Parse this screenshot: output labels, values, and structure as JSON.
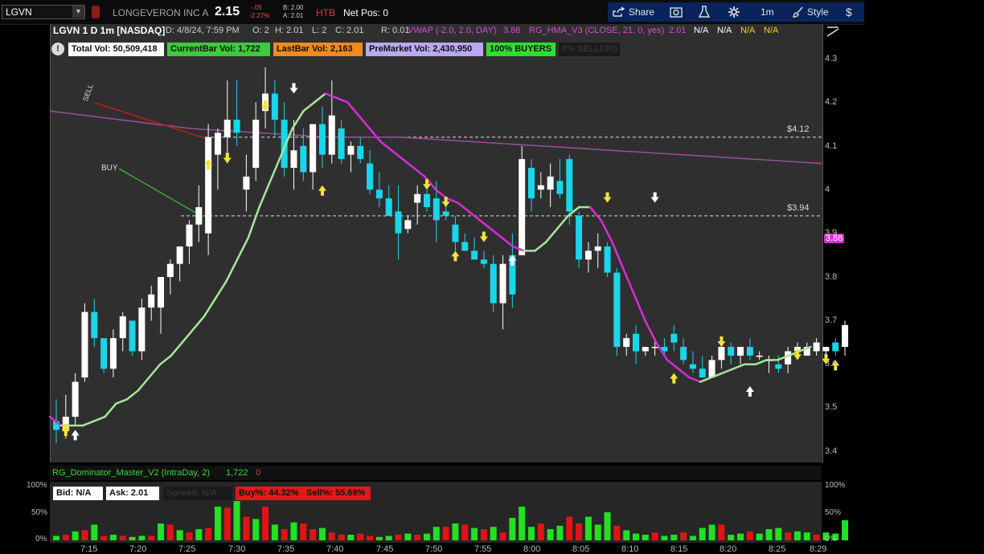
{
  "topbar": {
    "symbol": "LGVN",
    "company": "LONGEVERON INC A",
    "last": "2.15",
    "change": "-.05",
    "change_pct": "-2.27%",
    "bid": "B: 2.00",
    "ask": "A: 2.01",
    "htb": "HTB",
    "net_pos": "Net Pos: 0",
    "share_label": "Share",
    "timeframe": "1m",
    "style_label": "Style"
  },
  "header": {
    "title": "LGVN 1 D 1m [NASDAQ]",
    "date": "D: 4/8/24, 7:59 PM",
    "open": "O: 2",
    "high": "H: 2.01",
    "low": "L: 2",
    "close": "C: 2.01",
    "range": "R: 0.01",
    "vwap_label": "VWAP (-2.0, 2.0, DAY)",
    "vwap_value": "3.88",
    "hma_label": "RG_HMA_V3 (CLOSE, 21, 0, yes)",
    "hma_value": "2.01",
    "na1": "N/A",
    "na2": "N/A",
    "na3": "N/A",
    "na4": "N/A"
  },
  "stats": {
    "total_vol": "Total Vol: 50,509,418",
    "current_bar_vol": "CurrentBar Vol: 1,722",
    "last_bar_vol": "LastBar Vol: 2,163",
    "premarket_vol": "PreMarket Vol: 2,430,950",
    "buyers": "100% BUYERS",
    "sellers": "0% SELLERS"
  },
  "annotations": {
    "sell": "SELL",
    "buy": "BUY",
    "level_high": "$4.12",
    "level_low": "$3.94",
    "vwap_tag": "3.88"
  },
  "lower": {
    "study_label": "RG_Dominator_Master_V2 (IntraDay, 2)",
    "study_value": "1,722",
    "study_zero": "0",
    "bid": "Bid: N/A",
    "ask": "Ask: 2.01",
    "spread": "Spread: N/A",
    "buy_pct": "Buy%: 44.32%",
    "sell_pct": "Sell%: 55.68%",
    "axis_100_left": "100%",
    "axis_50_left": "50%",
    "axis_0_left": "0%",
    "axis_100_right": "100%",
    "axis_50_right": "50%",
    "axis_0_right": "0%"
  },
  "axes": {
    "price_ticks": [
      "4.3",
      "4.2",
      "4.1",
      "4",
      "3.9",
      "3.8",
      "3.7",
      "3.6",
      "3.5",
      "3.4"
    ],
    "time_ticks": [
      "7:15",
      "7:20",
      "7:25",
      "7:30",
      "7:35",
      "7:40",
      "7:45",
      "7:50",
      "7:55",
      "8:00",
      "8:05",
      "8:10",
      "8:15",
      "8:20",
      "8:25",
      "8:29"
    ]
  },
  "colors": {
    "up": "#ffffff",
    "down": "#19d6ea",
    "hma_up": "#a5e89a",
    "hma_down": "#d92bd9",
    "vwap": "#9b4f9b",
    "vol_buy": "#22e022",
    "vol_sell": "#e01414"
  },
  "chart_data": {
    "type": "candlestick",
    "x_start": "7:13",
    "x_end": "8:29",
    "interval": "1m",
    "ylim": [
      3.4,
      4.32
    ],
    "candles": [
      [
        3.47,
        3.52,
        3.42,
        3.45
      ],
      [
        3.45,
        3.53,
        3.43,
        3.48
      ],
      [
        3.48,
        3.58,
        3.46,
        3.56
      ],
      [
        3.57,
        3.74,
        3.56,
        3.72
      ],
      [
        3.72,
        3.75,
        3.64,
        3.66
      ],
      [
        3.66,
        3.66,
        3.58,
        3.59
      ],
      [
        3.59,
        3.68,
        3.57,
        3.66
      ],
      [
        3.66,
        3.72,
        3.63,
        3.71
      ],
      [
        3.7,
        3.7,
        3.62,
        3.63
      ],
      [
        3.63,
        3.75,
        3.61,
        3.73
      ],
      [
        3.73,
        3.78,
        3.7,
        3.76
      ],
      [
        3.73,
        3.8,
        3.67,
        3.8
      ],
      [
        3.8,
        3.84,
        3.76,
        3.83
      ],
      [
        3.83,
        3.87,
        3.79,
        3.87
      ],
      [
        3.87,
        3.93,
        3.83,
        3.92
      ],
      [
        3.92,
        4.01,
        3.88,
        3.96
      ],
      [
        3.9,
        4.15,
        3.85,
        4.12
      ],
      [
        4.08,
        4.14,
        4.0,
        4.13
      ],
      [
        4.12,
        4.25,
        4.06,
        4.16
      ],
      [
        4.16,
        4.25,
        4.1,
        4.13
      ],
      [
        4.0,
        4.08,
        3.95,
        4.03
      ],
      [
        4.05,
        4.2,
        4.02,
        4.16
      ],
      [
        4.18,
        4.28,
        4.14,
        4.22
      ],
      [
        4.22,
        4.25,
        4.12,
        4.16
      ],
      [
        4.16,
        4.2,
        4.03,
        4.05
      ],
      [
        4.05,
        4.16,
        4.0,
        4.09
      ],
      [
        4.1,
        4.14,
        4.02,
        4.04
      ],
      [
        4.04,
        4.1,
        4.0,
        4.15
      ],
      [
        4.15,
        4.19,
        4.05,
        4.08
      ],
      [
        4.08,
        4.25,
        4.06,
        4.17
      ],
      [
        4.14,
        4.16,
        4.06,
        4.07
      ],
      [
        4.08,
        4.11,
        4.04,
        4.1
      ],
      [
        4.1,
        4.12,
        4.06,
        4.07
      ],
      [
        4.06,
        4.09,
        3.99,
        4.0
      ],
      [
        4.0,
        4.04,
        3.96,
        3.98
      ],
      [
        3.98,
        4.01,
        3.94,
        3.94
      ],
      [
        3.95,
        4.01,
        3.84,
        3.9
      ],
      [
        3.91,
        3.94,
        3.9,
        3.93
      ],
      [
        3.97,
        4.01,
        3.92,
        3.99
      ],
      [
        3.99,
        4.0,
        3.95,
        3.96
      ],
      [
        3.98,
        4.02,
        3.88,
        3.93
      ],
      [
        3.95,
        3.97,
        3.93,
        3.94
      ],
      [
        3.92,
        3.94,
        3.86,
        3.88
      ],
      [
        3.88,
        3.9,
        3.86,
        3.86
      ],
      [
        3.86,
        3.89,
        3.84,
        3.84
      ],
      [
        3.84,
        3.86,
        3.82,
        3.83
      ],
      [
        3.83,
        3.85,
        3.72,
        3.74
      ],
      [
        3.74,
        3.85,
        3.68,
        3.83
      ],
      [
        3.85,
        3.9,
        3.73,
        3.76
      ],
      [
        3.85,
        4.1,
        3.85,
        4.07
      ],
      [
        4.05,
        4.07,
        3.95,
        3.98
      ],
      [
        4.0,
        4.04,
        3.98,
        4.01
      ],
      [
        4.0,
        4.06,
        3.96,
        4.03
      ],
      [
        4.02,
        4.07,
        3.98,
        3.99
      ],
      [
        4.07,
        4.08,
        3.92,
        3.95
      ],
      [
        3.94,
        3.95,
        3.82,
        3.84
      ],
      [
        3.84,
        3.88,
        3.81,
        3.86
      ],
      [
        3.86,
        3.9,
        3.82,
        3.87
      ],
      [
        3.87,
        3.88,
        3.8,
        3.81
      ],
      [
        3.81,
        3.82,
        3.62,
        3.64
      ],
      [
        3.64,
        3.67,
        3.62,
        3.66
      ],
      [
        3.67,
        3.69,
        3.6,
        3.63
      ],
      [
        3.63,
        3.64,
        3.62,
        3.64
      ],
      [
        3.64,
        3.66,
        3.62,
        3.64
      ],
      [
        3.64,
        3.66,
        3.62,
        3.63
      ],
      [
        3.67,
        3.69,
        3.63,
        3.65
      ],
      [
        3.64,
        3.66,
        3.6,
        3.61
      ],
      [
        3.6,
        3.63,
        3.58,
        3.59
      ],
      [
        3.59,
        3.62,
        3.57,
        3.57
      ],
      [
        3.57,
        3.62,
        3.57,
        3.61
      ],
      [
        3.61,
        3.65,
        3.59,
        3.64
      ],
      [
        3.64,
        3.65,
        3.6,
        3.62
      ],
      [
        3.62,
        3.64,
        3.6,
        3.64
      ],
      [
        3.64,
        3.66,
        3.61,
        3.62
      ],
      [
        3.62,
        3.63,
        3.61,
        3.62
      ],
      [
        3.61,
        3.62,
        3.58,
        3.61
      ],
      [
        3.6,
        3.62,
        3.58,
        3.59
      ],
      [
        3.6,
        3.64,
        3.58,
        3.63
      ],
      [
        3.63,
        3.65,
        3.61,
        3.64
      ],
      [
        3.62,
        3.65,
        3.62,
        3.64
      ],
      [
        3.63,
        3.66,
        3.62,
        3.65
      ],
      [
        3.63,
        3.64,
        3.62,
        3.64
      ],
      [
        3.65,
        3.66,
        3.62,
        3.63
      ],
      [
        3.64,
        3.7,
        3.62,
        3.69
      ]
    ],
    "hma": [
      [
        3.48,
        3.46
      ],
      [
        3.46,
        3.46
      ],
      [
        3.47,
        3.48
      ],
      [
        3.51,
        3.52
      ],
      [
        3.54,
        3.57
      ],
      [
        3.6,
        3.62
      ],
      [
        3.65,
        3.68
      ],
      [
        3.71,
        3.75
      ],
      [
        3.79,
        3.84
      ],
      [
        3.89,
        3.96
      ],
      [
        4.02,
        4.08
      ],
      [
        4.14,
        4.18
      ],
      [
        4.2,
        4.22
      ],
      [
        4.21,
        4.2
      ],
      [
        4.17,
        4.14
      ],
      [
        4.11,
        4.09
      ],
      [
        4.07,
        4.05
      ],
      [
        4.03,
        4.0
      ],
      [
        3.98,
        3.97
      ],
      [
        3.95,
        3.93
      ],
      [
        3.91,
        3.89
      ],
      [
        3.87,
        3.86
      ],
      [
        3.86,
        3.88
      ],
      [
        3.91,
        3.94
      ],
      [
        3.96,
        3.96
      ],
      [
        3.93,
        3.88
      ],
      [
        3.82,
        3.76
      ],
      [
        3.7,
        3.65
      ],
      [
        3.61,
        3.59
      ],
      [
        3.57,
        3.56
      ],
      [
        3.57,
        3.58
      ],
      [
        3.59,
        3.6
      ],
      [
        3.6,
        3.61
      ],
      [
        3.61,
        3.62
      ],
      [
        3.63,
        3.64
      ]
    ],
    "vwap": [
      [
        4.18,
        4.16
      ],
      [
        4.14,
        4.13
      ],
      [
        4.12,
        4.12
      ],
      [
        4.11,
        4.1
      ],
      [
        4.09,
        4.08
      ],
      [
        4.07,
        4.06
      ]
    ],
    "levels": [
      4.12,
      3.94
    ],
    "vwap_current": 3.88,
    "buy_arrows": [
      [
        7.14,
        3.46
      ],
      [
        7.29,
        4.07
      ],
      [
        7.41,
        4.01
      ],
      [
        7.55,
        3.86
      ],
      [
        7.78,
        3.58
      ],
      [
        7.95,
        3.61
      ]
    ],
    "sell_arrows": [
      [
        7.14,
        3.44
      ],
      [
        7.31,
        4.06
      ],
      [
        7.35,
        4.18
      ],
      [
        7.52,
        4.0
      ],
      [
        7.54,
        3.96
      ],
      [
        7.58,
        3.88
      ],
      [
        7.71,
        3.97
      ],
      [
        7.83,
        3.64
      ],
      [
        7.91,
        3.61
      ],
      [
        7.94,
        3.6
      ]
    ],
    "white_up_arrows": [
      [
        7.15,
        3.45
      ],
      [
        7.61,
        3.85
      ],
      [
        7.86,
        3.55
      ]
    ],
    "white_down_arrows": [
      [
        7.38,
        4.22
      ],
      [
        7.76,
        3.97
      ]
    ],
    "volume_pct": [
      [
        0,
        8
      ],
      [
        1,
        10
      ],
      [
        0,
        16
      ],
      [
        1,
        18
      ],
      [
        0,
        28
      ],
      [
        1,
        8
      ],
      [
        0,
        10
      ],
      [
        1,
        8
      ],
      [
        0,
        6
      ],
      [
        0,
        8
      ],
      [
        1,
        8
      ],
      [
        0,
        30
      ],
      [
        1,
        28
      ],
      [
        0,
        18
      ],
      [
        1,
        14
      ],
      [
        0,
        20
      ],
      [
        1,
        22
      ],
      [
        0,
        60
      ],
      [
        1,
        58
      ],
      [
        0,
        70
      ],
      [
        1,
        42
      ],
      [
        0,
        38
      ],
      [
        1,
        60
      ],
      [
        0,
        28
      ],
      [
        1,
        20
      ],
      [
        0,
        32
      ],
      [
        1,
        30
      ],
      [
        1,
        20
      ],
      [
        0,
        22
      ],
      [
        1,
        14
      ],
      [
        1,
        10
      ],
      [
        0,
        10
      ],
      [
        1,
        12
      ],
      [
        1,
        8
      ],
      [
        0,
        6
      ],
      [
        0,
        8
      ],
      [
        1,
        10
      ],
      [
        0,
        12
      ],
      [
        1,
        10
      ],
      [
        0,
        12
      ],
      [
        0,
        24
      ],
      [
        1,
        24
      ],
      [
        0,
        30
      ],
      [
        1,
        28
      ],
      [
        0,
        22
      ],
      [
        1,
        20
      ],
      [
        0,
        24
      ],
      [
        1,
        14
      ],
      [
        0,
        40
      ],
      [
        0,
        60
      ],
      [
        0,
        24
      ],
      [
        1,
        30
      ],
      [
        0,
        20
      ],
      [
        0,
        26
      ],
      [
        1,
        42
      ],
      [
        1,
        30
      ],
      [
        0,
        42
      ],
      [
        0,
        28
      ],
      [
        0,
        50
      ],
      [
        1,
        26
      ],
      [
        0,
        18
      ],
      [
        0,
        12
      ],
      [
        0,
        10
      ],
      [
        1,
        14
      ],
      [
        0,
        8
      ],
      [
        0,
        10
      ],
      [
        1,
        14
      ],
      [
        0,
        8
      ],
      [
        0,
        22
      ],
      [
        0,
        28
      ],
      [
        1,
        28
      ],
      [
        0,
        10
      ],
      [
        0,
        12
      ],
      [
        1,
        16
      ],
      [
        0,
        12
      ],
      [
        0,
        20
      ],
      [
        0,
        22
      ],
      [
        1,
        14
      ],
      [
        0,
        16
      ],
      [
        0,
        14
      ],
      [
        1,
        10
      ],
      [
        0,
        14
      ],
      [
        0,
        12
      ],
      [
        0,
        36
      ]
    ]
  }
}
